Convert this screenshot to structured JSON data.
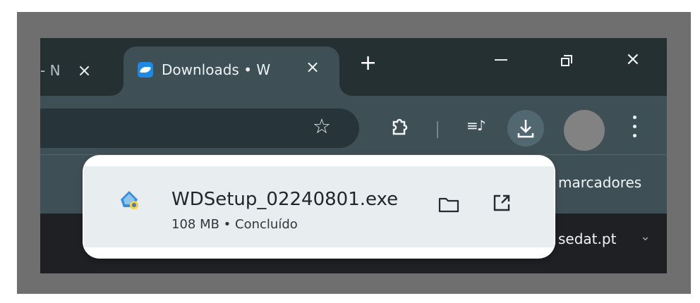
{
  "browser": {
    "tabs": [
      {
        "title": "- N",
        "active": false
      },
      {
        "title": "Downloads • W",
        "active": true
      }
    ],
    "new_tab_label": "+",
    "tab_close_glyph": "×",
    "window_controls": {
      "minimize": "—",
      "restore": "❐",
      "close": "×"
    }
  },
  "toolbar": {
    "bookmark_star": "☆",
    "extensions_icon": "extensions-icon",
    "playlist_icon": "reading-list-icon",
    "download_icon": "download-icon",
    "menu_icon": "more-vert-icon"
  },
  "bookmarks_bar": {
    "label": "marcadores"
  },
  "page": {
    "domain_fragment": "sedat.pt",
    "chevron": "⌄"
  },
  "download_bubble": {
    "file_name": "WDSetup_02240801.exe",
    "status": "108 MB • Concluído",
    "actions": [
      "folder-icon",
      "open-external-icon"
    ]
  },
  "colors": {
    "tab_strip": "#253033",
    "toolbar": "#3f4f56",
    "accent": "#1e88e5",
    "bubble_bg": "#ffffff",
    "item_bg": "#e8edef"
  }
}
